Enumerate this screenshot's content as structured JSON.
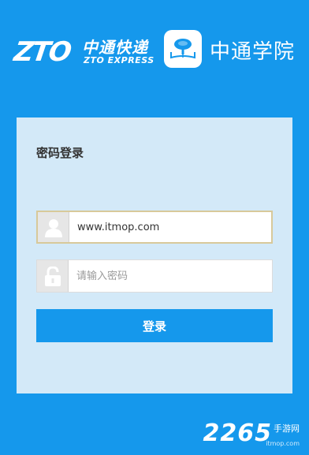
{
  "header": {
    "zto_mark": "ZTO",
    "zto_cn": "中通快递",
    "zto_en": "ZTO EXPRESS",
    "school_name": "中通学院"
  },
  "login": {
    "title": "密码登录",
    "username_value": "www.itmop.com",
    "password_placeholder": "请输入密码",
    "submit_label": "登录"
  },
  "watermark": {
    "number": "2265",
    "suffix": "手游网",
    "url": "itmop.com"
  },
  "colors": {
    "background": "#1598ec",
    "card": "#d3e9f8",
    "button": "#1598ec",
    "focus_border": "#d8c99a"
  },
  "icons": [
    "user-icon",
    "lock-icon",
    "book-tree-icon"
  ]
}
